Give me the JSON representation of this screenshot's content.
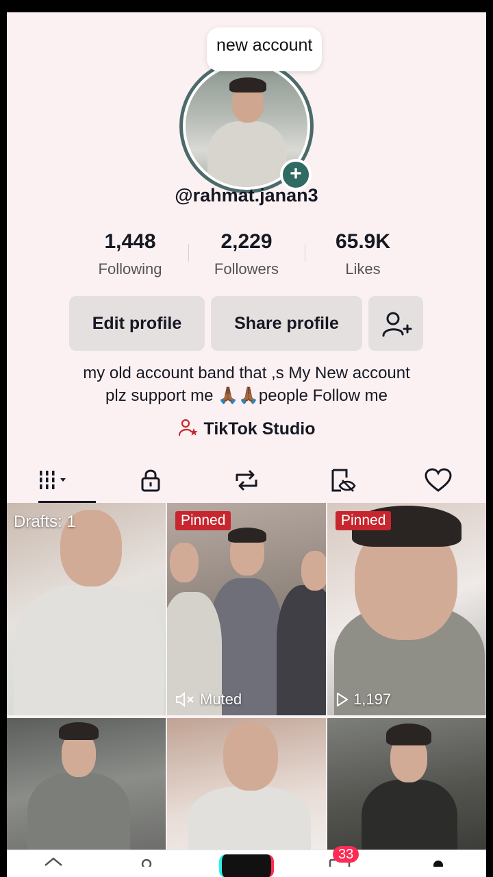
{
  "profile": {
    "bubble_text": "new account",
    "username": "@rahmat.janan3",
    "plus_glyph": "+"
  },
  "stats": [
    {
      "value": "1,448",
      "label": "Following"
    },
    {
      "value": "2,229",
      "label": "Followers"
    },
    {
      "value": "65.9K",
      "label": "Likes"
    }
  ],
  "buttons": {
    "edit": "Edit profile",
    "share": "Share profile",
    "add_friend_icon": "person-add-icon"
  },
  "bio": {
    "line1": "my old account band that ,s My New account",
    "line2": "plz support me 🙏🏾🙏🏾people Follow me"
  },
  "studio": {
    "label": "TikTok Studio",
    "icon": "person-star-icon"
  },
  "tabs": [
    {
      "name": "videos",
      "icon": "grid-icon",
      "active": true
    },
    {
      "name": "private",
      "icon": "lock-icon"
    },
    {
      "name": "reposts",
      "icon": "repost-icon"
    },
    {
      "name": "hidden",
      "icon": "eye-off-icon"
    },
    {
      "name": "liked",
      "icon": "heart-icon"
    }
  ],
  "grid": {
    "drafts_label": "Drafts: 1",
    "pinned_label": "Pinned",
    "muted_label": "Muted",
    "views_label": "1,197"
  },
  "nav": {
    "inbox_count": "33"
  },
  "colors": {
    "pinned": "#c7262f",
    "accent": "#fe2c55",
    "background": "#fbf1f2"
  }
}
